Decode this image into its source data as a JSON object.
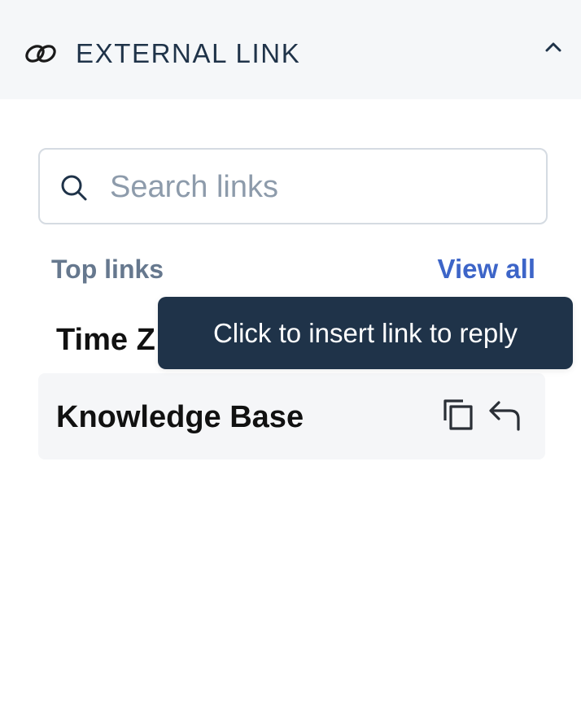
{
  "header": {
    "title": "EXTERNAL LINK",
    "icon": "link-icon",
    "collapse_icon": "chevron-up-icon"
  },
  "search": {
    "placeholder": "Search links",
    "value": "",
    "icon": "search-icon"
  },
  "top_links": {
    "label": "Top links",
    "view_all_label": "View all",
    "items": [
      {
        "label": "Time Z"
      },
      {
        "label": "Knowledge Base",
        "actions": [
          "copy-icon",
          "reply-icon"
        ]
      }
    ]
  },
  "tooltip": {
    "text": "Click to insert link to reply"
  },
  "colors": {
    "header_bg": "#f5f7f9",
    "header_text": "#1f3349",
    "accent": "#3d65c8",
    "muted_label": "#66788e",
    "tooltip_bg": "#1f3349",
    "hover_row_bg": "#f5f6f8",
    "search_border": "#d5dbe2"
  }
}
